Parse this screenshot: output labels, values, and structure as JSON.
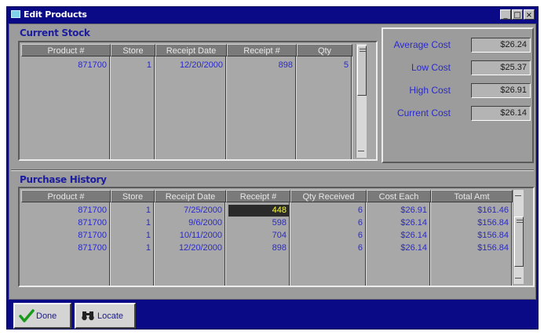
{
  "window": {
    "title": "Edit Products",
    "controls": [
      "_",
      "□",
      "×"
    ]
  },
  "current_stock": {
    "title": "Current Stock",
    "columns": [
      "Product #",
      "Store",
      "Receipt Date",
      "Receipt #",
      "Qty"
    ],
    "rows": [
      [
        "871700",
        "1",
        "12/20/2000",
        "898",
        "5"
      ]
    ]
  },
  "costs": {
    "average": {
      "label": "Average Cost",
      "value": "$26.24"
    },
    "low": {
      "label": "Low Cost",
      "value": "$25.37"
    },
    "high": {
      "label": "High Cost",
      "value": "$26.91"
    },
    "current": {
      "label": "Current Cost",
      "value": "$26.14"
    }
  },
  "purchase_history": {
    "title": "Purchase History",
    "columns": [
      "Product #",
      "Store",
      "Receipt Date",
      "Receipt #",
      "Qty Received",
      "Cost Each",
      "Total Amt"
    ],
    "rows": [
      [
        "871700",
        "1",
        "7/25/2000",
        "448",
        "6",
        "$26.91",
        "$161.46"
      ],
      [
        "871700",
        "1",
        "9/6/2000",
        "598",
        "6",
        "$26.14",
        "$156.84"
      ],
      [
        "871700",
        "1",
        "10/11/2000",
        "704",
        "6",
        "$26.14",
        "$156.84"
      ],
      [
        "871700",
        "1",
        "12/20/2000",
        "898",
        "6",
        "$26.14",
        "$156.84"
      ]
    ]
  },
  "buttons": {
    "done": {
      "label": "Done",
      "icon": "checkmark-icon"
    },
    "locate": {
      "label": "Locate",
      "icon": "binoculars-icon"
    }
  },
  "colors": {
    "frame": "#0a0a86",
    "panel": "#9c9c9c",
    "header": "#7a7a7a",
    "value_text": "#2a2ac8",
    "selected_bg": "#2a2a2a",
    "selected_text": "#ffff33"
  }
}
